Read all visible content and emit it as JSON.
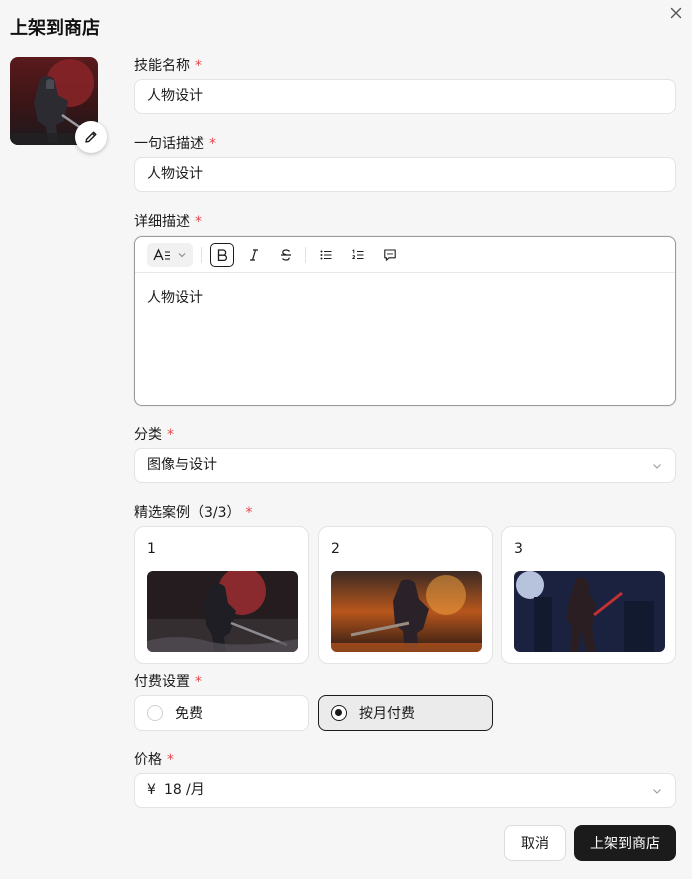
{
  "dialog": {
    "title": "上架到商店"
  },
  "form": {
    "name": {
      "label": "技能名称",
      "required_mark": "*",
      "value": "人物设计"
    },
    "summary": {
      "label": "一句话描述",
      "required_mark": "*",
      "value": "人物设计"
    },
    "detail": {
      "label": "详细描述",
      "required_mark": "*",
      "content": "人物设计",
      "toolbar": [
        "text-style-icon",
        "bold-icon",
        "italic-icon",
        "strikethrough-icon",
        "bullet-list-icon",
        "ordered-list-icon",
        "comment-icon"
      ]
    },
    "category": {
      "label": "分类",
      "required_mark": "*",
      "value": "图像与设计"
    },
    "cases": {
      "label": "精选案例（3/3）",
      "required_mark": "*",
      "items": [
        {
          "num": "1"
        },
        {
          "num": "2"
        },
        {
          "num": "3"
        }
      ]
    },
    "payment": {
      "label": "付费设置",
      "required_mark": "*",
      "options": [
        {
          "label": "免费",
          "selected": false
        },
        {
          "label": "按月付费",
          "selected": true
        }
      ]
    },
    "price": {
      "label": "价格",
      "required_mark": "*",
      "currency": "¥",
      "value": "18",
      "unit": "/月"
    }
  },
  "actions": {
    "cancel": "取消",
    "submit": "上架到商店"
  },
  "colors": {
    "accent": "#1b1b1b",
    "required": "#e5484d",
    "background": "#f6f6f6"
  }
}
